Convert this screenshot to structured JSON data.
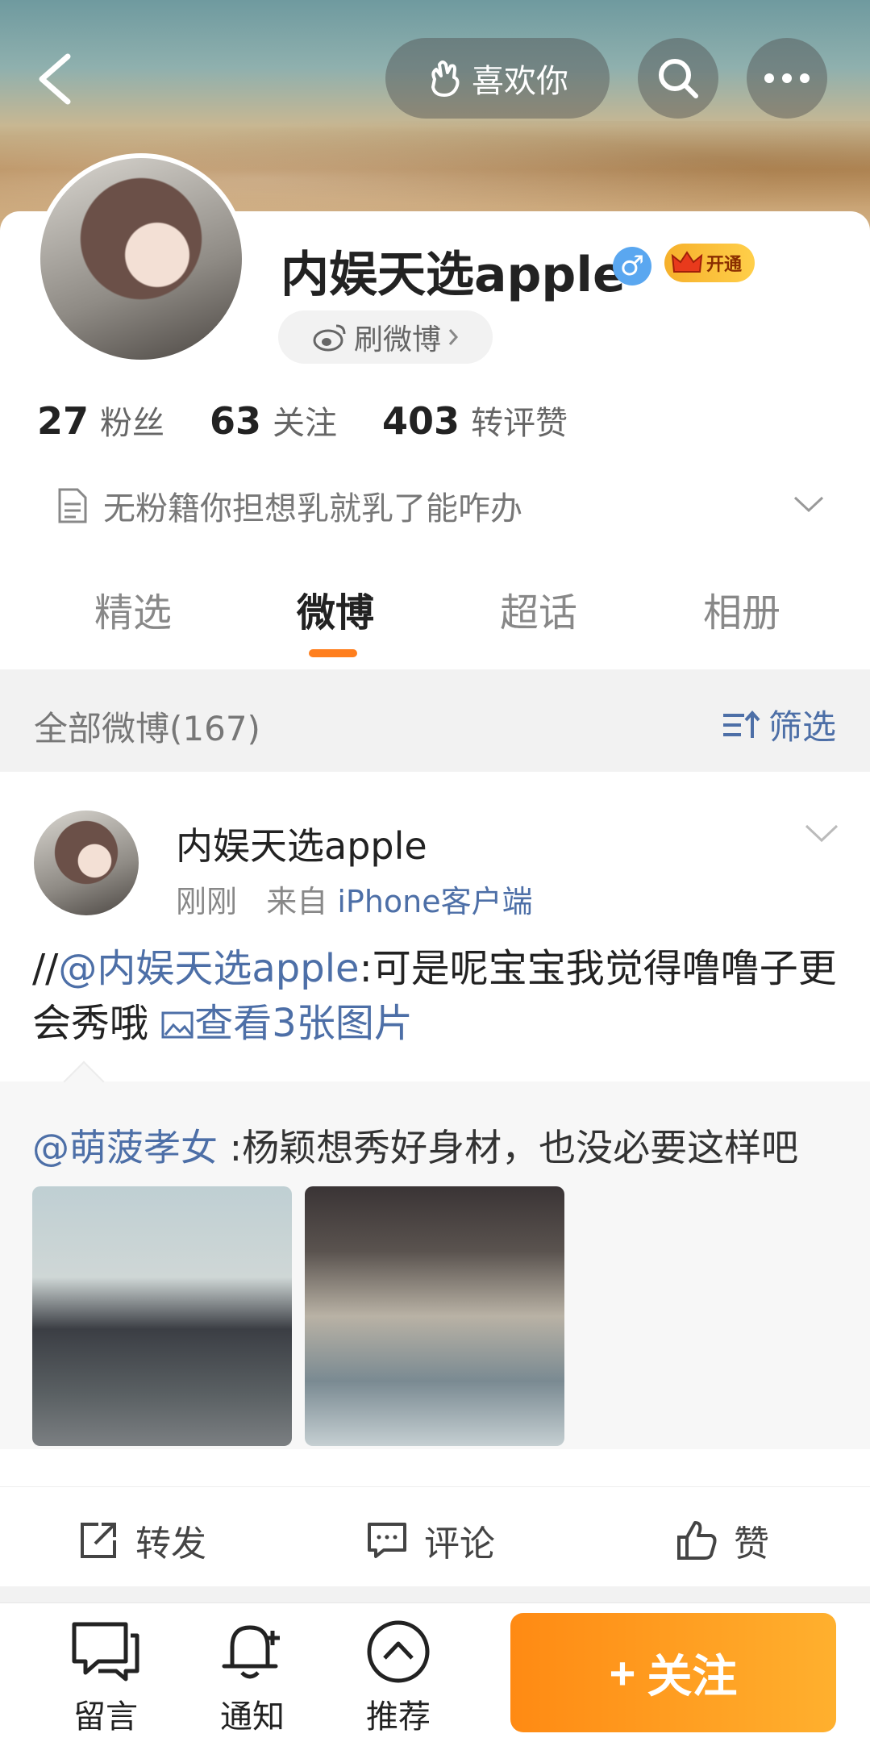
{
  "header": {
    "like_label": "喜欢你"
  },
  "profile": {
    "name": "内娱天选apple",
    "gender_symbol": "♂",
    "vip_label": "开通",
    "shua_label": "刷微博",
    "stats": [
      {
        "num": "27",
        "label": "粉丝"
      },
      {
        "num": "63",
        "label": "关注"
      },
      {
        "num": "403",
        "label": "转评赞"
      }
    ],
    "bio": "无粉籍你担想乳就乳了能咋办"
  },
  "tabs": [
    {
      "label": "精选",
      "active": false
    },
    {
      "label": "微博",
      "active": true
    },
    {
      "label": "超话",
      "active": false
    },
    {
      "label": "相册",
      "active": false
    }
  ],
  "filter": {
    "all_label": "全部微博(167)",
    "filter_label": "筛选"
  },
  "post": {
    "author": "内娱天选apple",
    "time": "刚刚",
    "from_prefix": "来自",
    "source": "iPhone客户端",
    "text_prefix": "//",
    "mention": "@内娱天选apple",
    "text_body": ":可是呢宝宝我觉得噜噜子更会秀哦",
    "images_link": "查看3张图片",
    "repost_mention": "@萌菠孝女",
    "repost_text": " :杨颖想秀好身材，也没必要这样吧",
    "actions": [
      {
        "label": "转发",
        "icon": "share-icon"
      },
      {
        "label": "评论",
        "icon": "comment-icon"
      },
      {
        "label": "赞",
        "icon": "thumbs-up-icon"
      }
    ]
  },
  "bottom_bar": {
    "items": [
      {
        "label": "留言",
        "icon": "message-icon"
      },
      {
        "label": "通知",
        "icon": "bell-icon"
      },
      {
        "label": "推荐",
        "icon": "chevron-up-circle-icon"
      }
    ],
    "follow_label": "关注"
  },
  "colors": {
    "accent": "#ff7f1e",
    "link": "#4d6fa7"
  }
}
